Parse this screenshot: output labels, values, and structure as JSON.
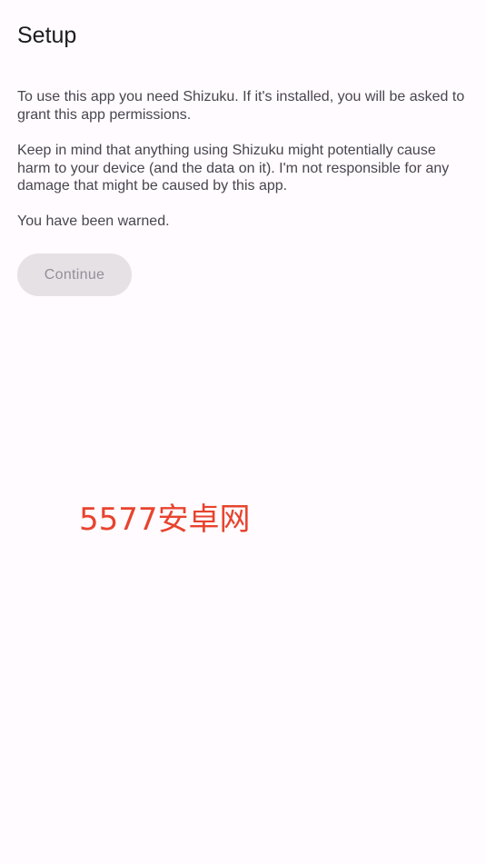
{
  "screen": {
    "title": "Setup"
  },
  "content": {
    "paragraphs": [
      "To use this app you need Shizuku. If it's installed, you will be asked to grant this app permissions.",
      "Keep in mind that anything using Shizuku might potentially cause harm to your device (and the data on it). I'm not responsible for any damage that might be caused by this app.",
      "You have been warned."
    ]
  },
  "actions": {
    "continue_label": "Continue",
    "continue_state": "disabled"
  },
  "watermark": {
    "text": "5577安卓网"
  },
  "colors": {
    "background": "#fffbfe",
    "button_disabled_bg": "#e6e1e5",
    "button_disabled_text": "#938f99",
    "watermark": "#e8432e"
  }
}
